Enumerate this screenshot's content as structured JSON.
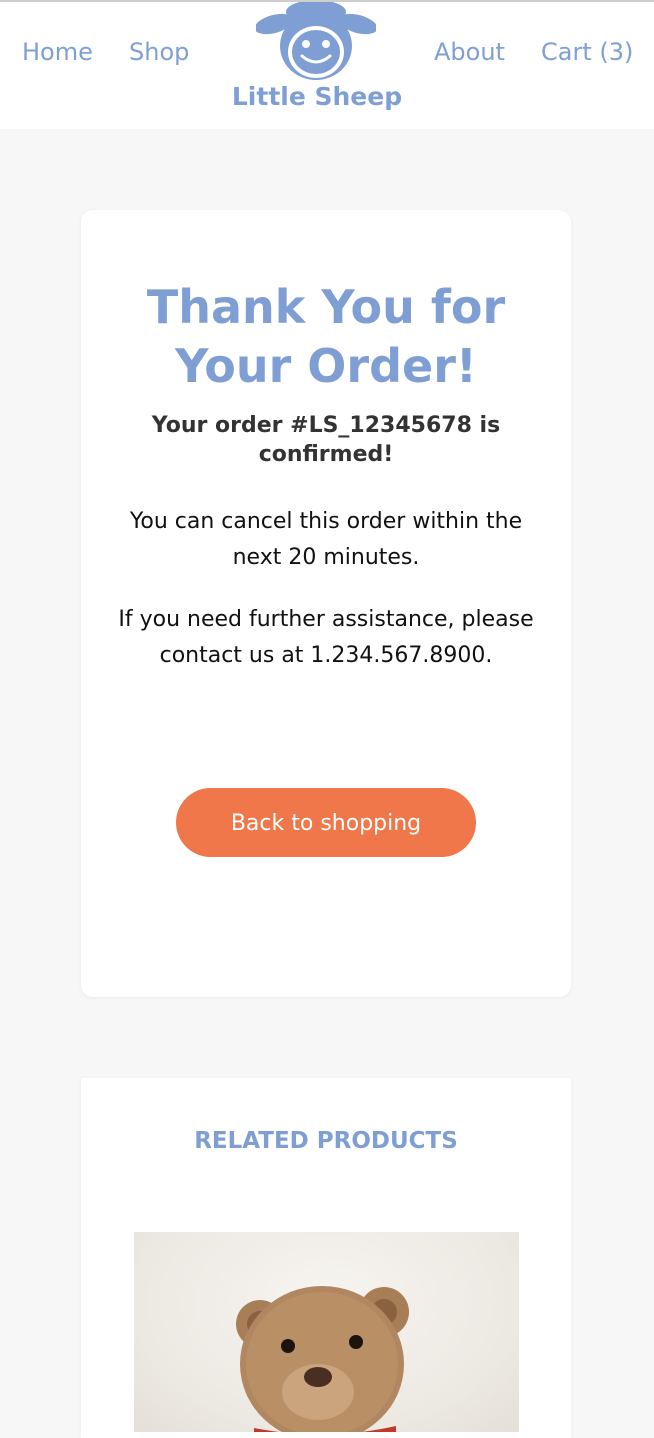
{
  "nav": {
    "home": "Home",
    "shop": "Shop",
    "about": "About",
    "cart": "Cart (3)"
  },
  "brand": {
    "name": "Little Sheep",
    "accent_color": "#7f9fd4"
  },
  "confirmation": {
    "title": "Thank You for Your Order!",
    "order_message": "Your order #LS_12345678 is confirmed!",
    "cancel_note": "You can cancel this order within the next 20 minutes.",
    "help_note": "If you need further assistance, please contact us at 1.234.567.8900.",
    "button_label": "Back to shopping",
    "button_color": "#ef7749"
  },
  "related": {
    "heading": "RELATED PRODUCTS",
    "products": [
      {
        "image_icon": "teddy-bear-image"
      }
    ]
  }
}
